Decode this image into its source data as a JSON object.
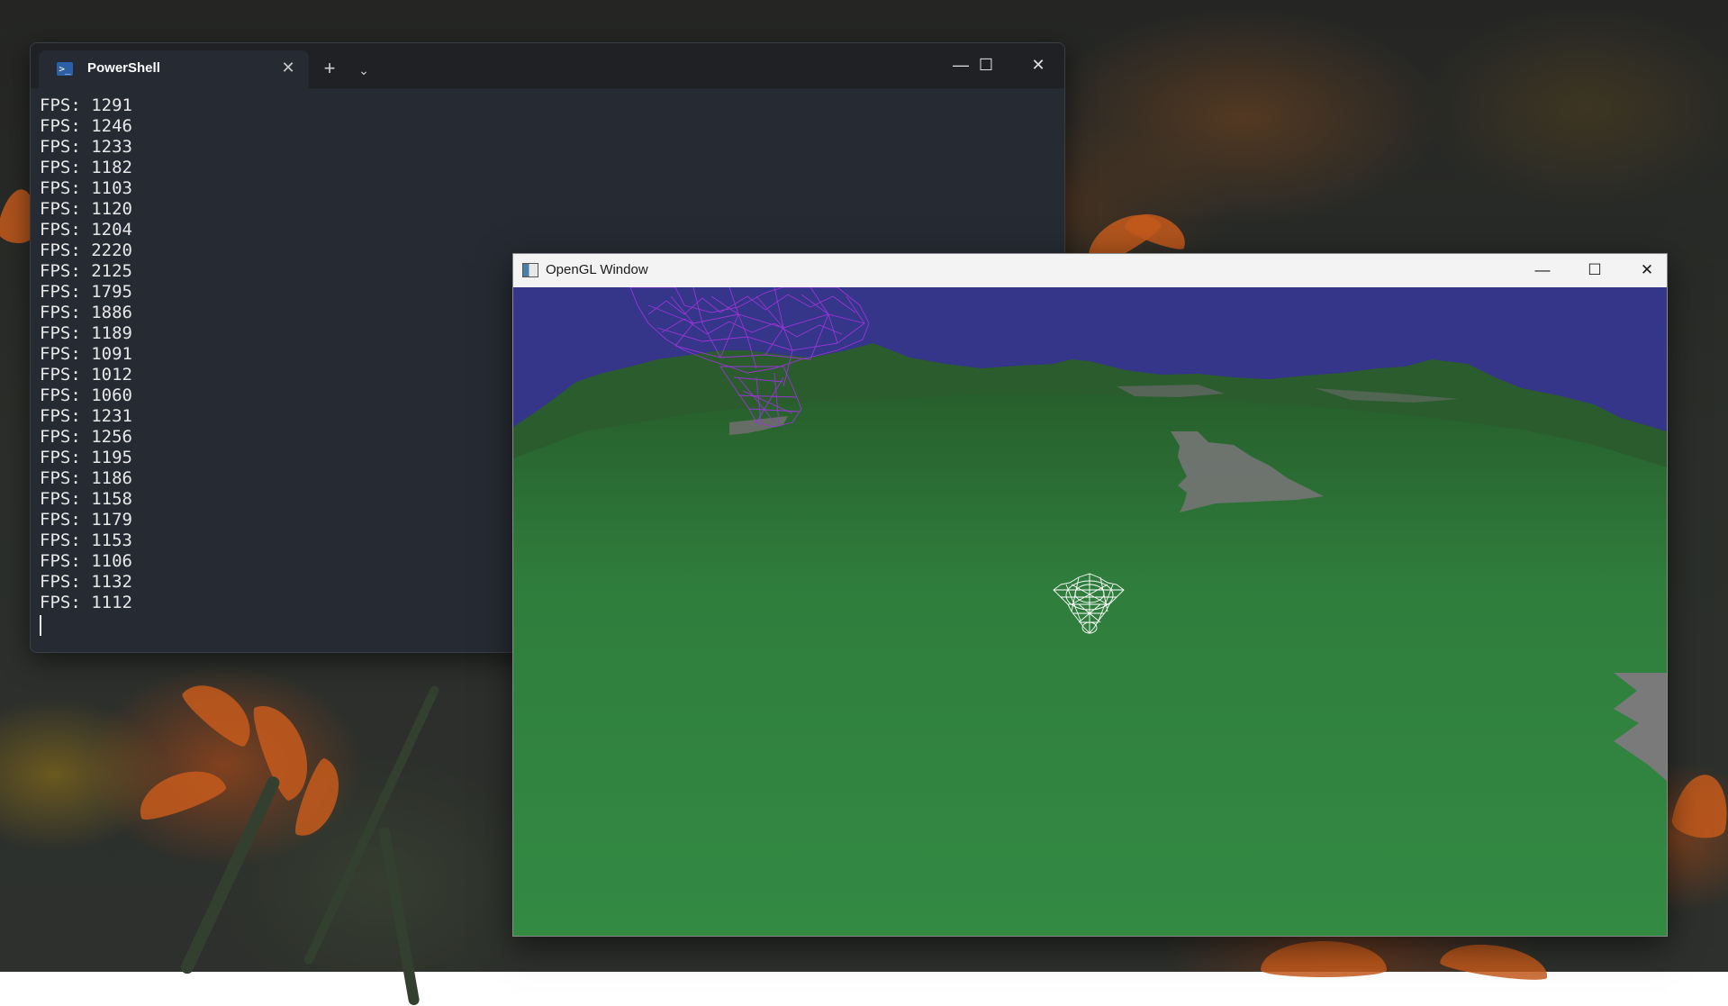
{
  "desktop": {
    "wallpaper": "orange-flowers-dark"
  },
  "powershell": {
    "tab_title": "PowerShell",
    "tab_icon": "powershell-icon",
    "close_tab_glyph": "✕",
    "new_tab_glyph": "+",
    "dropdown_glyph": "⌄",
    "minimize_glyph": "—",
    "maximize_glyph": "☐",
    "close_glyph": "✕",
    "lines": [
      "FPS: 1291",
      "FPS: 1246",
      "FPS: 1233",
      "FPS: 1182",
      "FPS: 1103",
      "FPS: 1120",
      "FPS: 1204",
      "FPS: 2220",
      "FPS: 2125",
      "FPS: 1795",
      "FPS: 1886",
      "FPS: 1189",
      "FPS: 1091",
      "FPS: 1012",
      "FPS: 1060",
      "FPS: 1231",
      "FPS: 1256",
      "FPS: 1195",
      "FPS: 1186",
      "FPS: 1158",
      "FPS: 1179",
      "FPS: 1153",
      "FPS: 1106",
      "FPS: 1132",
      "FPS: 1112"
    ]
  },
  "opengl_window": {
    "title": "OpenGL Window",
    "icon": "application-icon",
    "minimize_glyph": "—",
    "maximize_glyph": "☐",
    "close_glyph": "✕",
    "scene": {
      "sky_color": "#35358a",
      "ground_color_near": "#318a41",
      "ground_color_far": "#2c6e34",
      "rock_color": "#767676",
      "wireframe_far_color": "#9b35d6",
      "wireframe_near_color": "#ffffff"
    }
  },
  "colors": {
    "terminal_bg": "#262b33",
    "terminal_text": "#e8e8e8",
    "titlebar_dark": "#1f2124"
  }
}
